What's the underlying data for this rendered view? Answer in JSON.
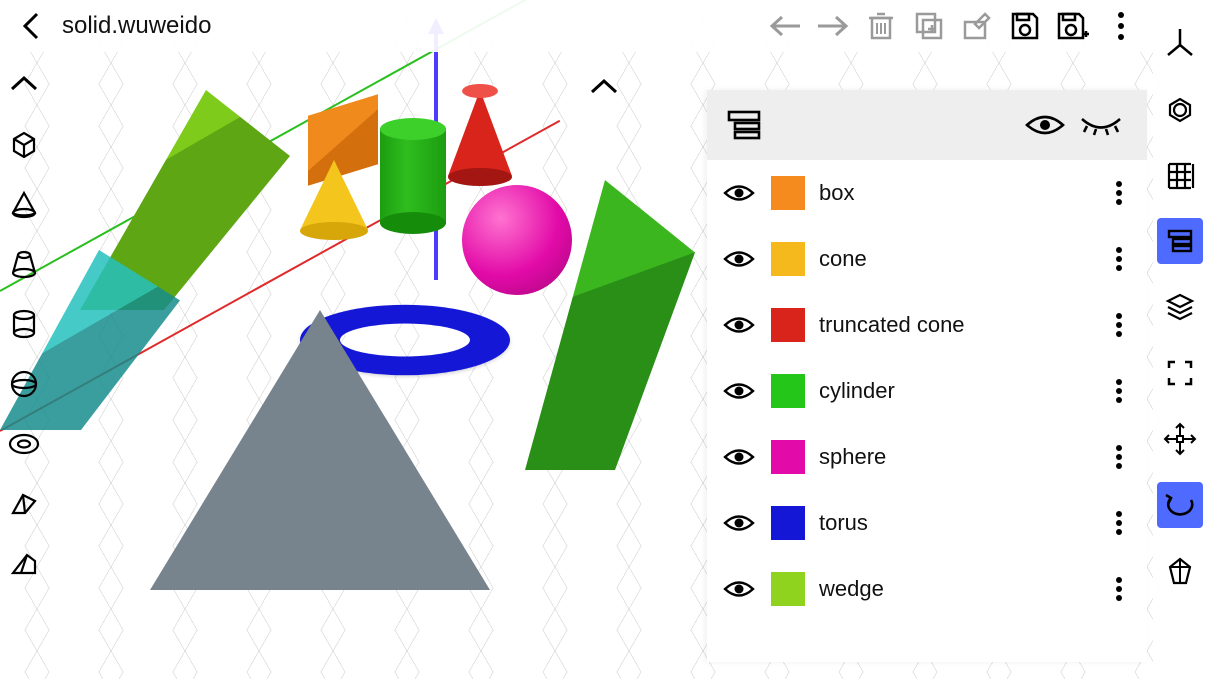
{
  "header": {
    "title": "solid.wuweido"
  },
  "panel": {
    "objects": [
      {
        "label": "box",
        "color": "#f58a1f"
      },
      {
        "label": "cone",
        "color": "#f5b81d"
      },
      {
        "label": "truncated cone",
        "color": "#d8241b"
      },
      {
        "label": "cylinder",
        "color": "#24c61a"
      },
      {
        "label": "sphere",
        "color": "#e20aa8"
      },
      {
        "label": "torus",
        "color": "#1418d6"
      },
      {
        "label": "wedge",
        "color": "#8fd31e"
      }
    ]
  },
  "right_tools": [
    {
      "name": "axes-icon",
      "active": false
    },
    {
      "name": "isometric-icon",
      "active": false
    },
    {
      "name": "grid-icon",
      "active": false
    },
    {
      "name": "object-list-icon",
      "active": true
    },
    {
      "name": "layers-icon",
      "active": false
    },
    {
      "name": "fullscreen-icon",
      "active": false
    },
    {
      "name": "move-handles-icon",
      "active": false
    },
    {
      "name": "undo-rotate-icon",
      "active": true
    },
    {
      "name": "transform-icon",
      "active": false
    }
  ],
  "left_tools": [
    "collapse-up-icon",
    "cube-icon",
    "cone-outline-icon",
    "truncated-cone-outline-icon",
    "cylinder-outline-icon",
    "sphere-outline-icon",
    "torus-outline-icon",
    "prism-icon",
    "wedge-outline-icon"
  ],
  "top_actions": [
    "nav-back-arrow-icon",
    "nav-forward-arrow-icon",
    "delete-icon",
    "copy-icon",
    "edit-icon",
    "save-icon",
    "save-as-icon",
    "menu-more-icon"
  ]
}
